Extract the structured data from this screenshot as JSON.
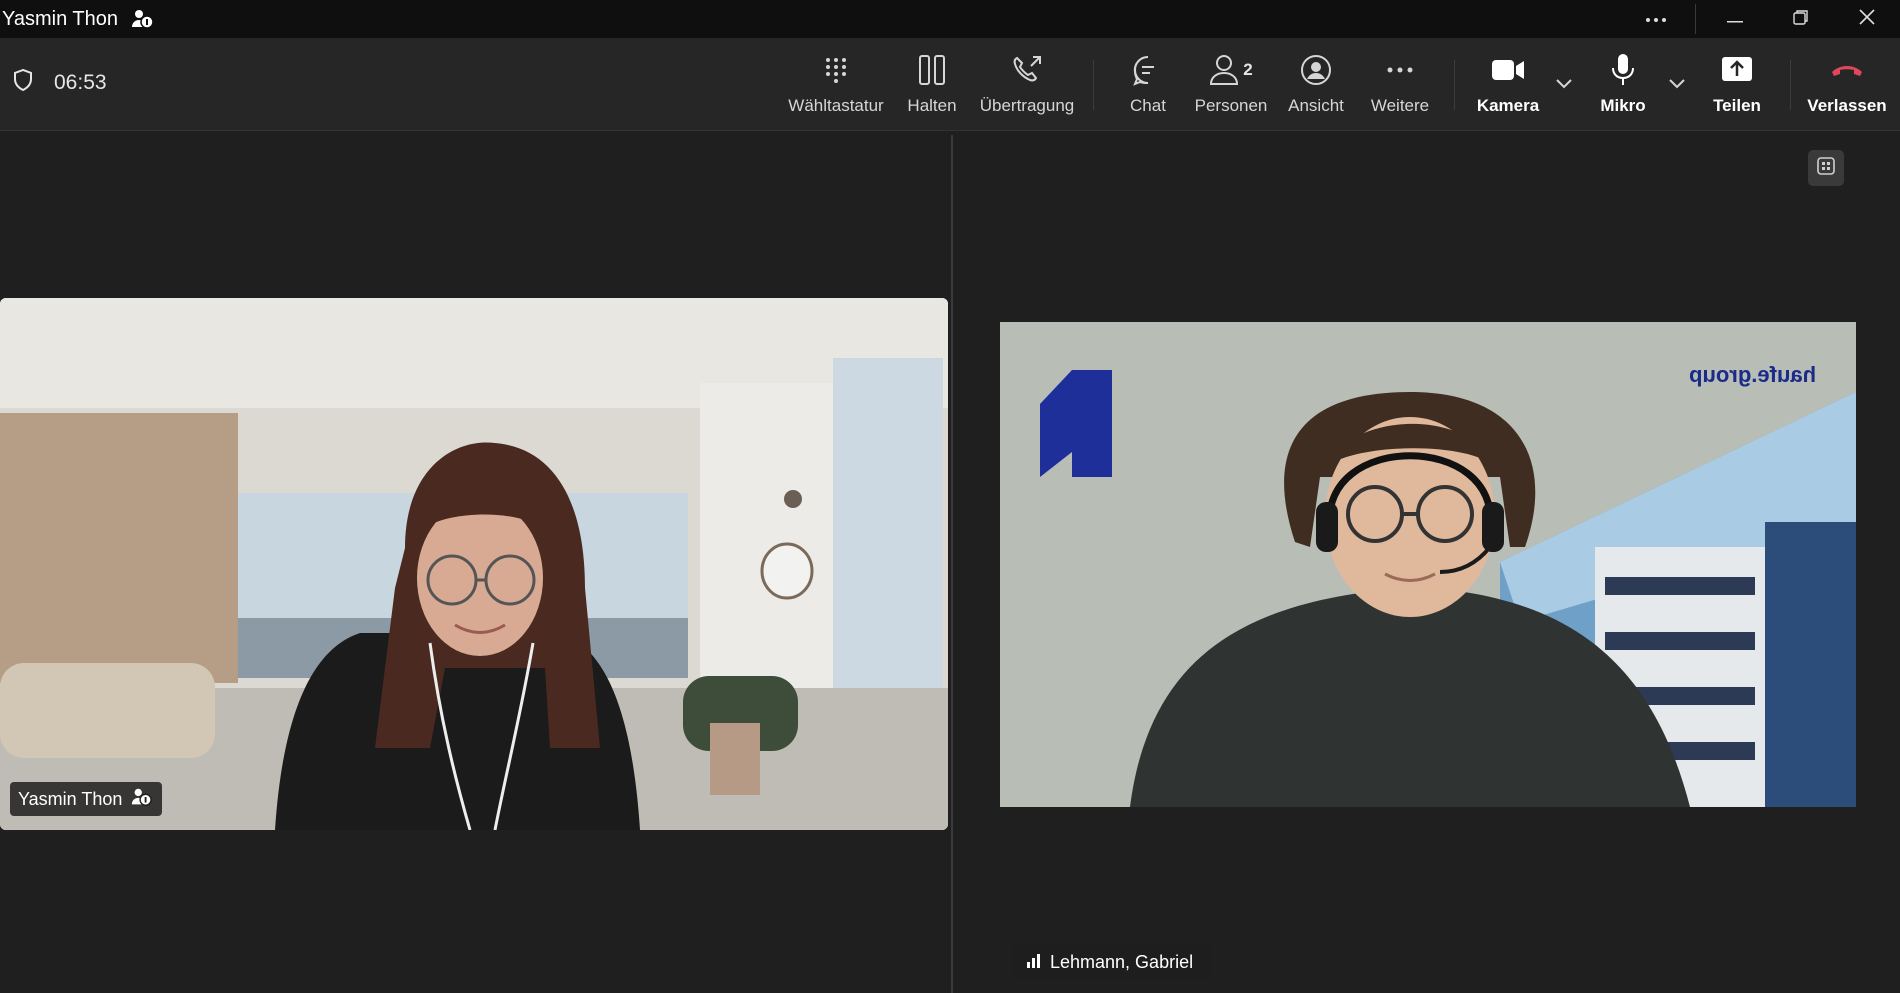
{
  "titlebar": {
    "title": "Yasmin Thon",
    "icons": [
      "org-member-icon",
      "more-icon",
      "minimize-icon",
      "restore-icon",
      "close-icon"
    ]
  },
  "toolbar": {
    "timer": "06:53",
    "buttons": {
      "dialpad": "Wähltastatur",
      "hold": "Halten",
      "transfer": "Übertragung",
      "chat": "Chat",
      "people": "Personen",
      "people_count": "2",
      "view": "Ansicht",
      "more": "Weitere",
      "camera": "Kamera",
      "mic": "Mikro",
      "share": "Teilen",
      "leave": "Verlassen"
    }
  },
  "participants": {
    "left_name": "Yasmin Thon",
    "right_name": "Lehmann, Gabriel"
  },
  "background": {
    "brand_text": "haufe.group"
  },
  "colors": {
    "leave": "#e0475a",
    "brand": "#1a2b8a"
  }
}
